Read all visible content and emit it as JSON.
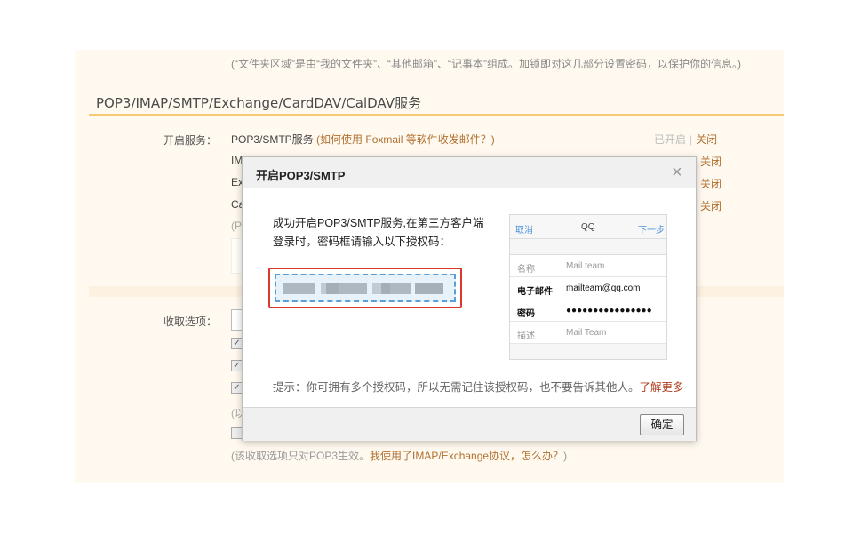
{
  "top_note": "(“文件夹区域”是由“我的文件夹”、“其他邮箱”、“记事本”组成。加锁即对这几部分设置密码，以保护你的信息。)",
  "section_title": "POP3/IMAP/SMTP/Exchange/CardDAV/CalDAV服务",
  "services": {
    "label": "开启服务：",
    "rows": [
      {
        "name": "POP3/SMTP服务",
        "link": "(如何使用 Foxmail 等软件收发邮件？)",
        "status_on": "已开启",
        "sep": "|",
        "close": "关闭"
      },
      {
        "name": "IM",
        "close": "关闭"
      },
      {
        "name": "Ex",
        "close": "关闭"
      },
      {
        "name": "Ca",
        "close": "关闭"
      }
    ],
    "partial_note": "(P"
  },
  "receive": {
    "label": "收取选项：",
    "partial_note": "(以"
  },
  "bottom_note": {
    "text": "(该收取选项只对POP3生效。",
    "link": "我使用了IMAP/Exchange协议，怎么办？",
    "end": ")"
  },
  "modal": {
    "title": "开启POP3/SMTP",
    "close_glyph": "×",
    "message": "成功开启POP3/SMTP服务,在第三方客户端登录时，密码框请输入以下授权码：",
    "tip": "提示：你可拥有多个授权码，所以无需记住该授权码，也不要告诉其他人。",
    "tip_link": "了解更多",
    "ok_label": "确定",
    "phone": {
      "cancel": "取消",
      "title": "QQ",
      "next": "下一步",
      "rows": [
        {
          "key": "名称",
          "value": "Mail team"
        },
        {
          "key": "电子邮件",
          "value": "mailteam@qq.com"
        },
        {
          "key": "密码",
          "value": "●●●●●●●●●●●●●●●●"
        },
        {
          "key": "描述",
          "value": "Mail Team"
        }
      ]
    }
  },
  "colors": {
    "accent_line": "#f5c975",
    "link": "#b07030",
    "highlight_border": "#d83a2e",
    "code_border": "#5aa0d8"
  }
}
